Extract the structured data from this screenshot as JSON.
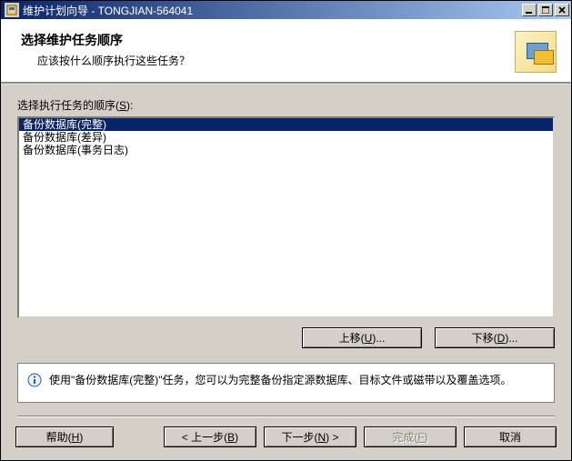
{
  "window": {
    "title": "维护计划向导 - TONGJIAN-564041"
  },
  "header": {
    "heading": "选择维护任务顺序",
    "subheading": "应该按什么顺序执行这些任务？"
  },
  "list_label_prefix": "选择执行任务的顺序(",
  "list_label_hotkey": "S",
  "list_label_suffix": "):",
  "tasks": [
    {
      "label": "备份数据库(完整)",
      "selected": true
    },
    {
      "label": "备份数据库(差异)",
      "selected": false
    },
    {
      "label": "备份数据库(事务日志)",
      "selected": false
    }
  ],
  "buttons": {
    "move_up": {
      "text": "上移(",
      "hotkey": "U",
      "suffix": ")..."
    },
    "move_down": {
      "text": "下移(",
      "hotkey": "D",
      "suffix": ")..."
    },
    "help": {
      "text": "帮助(",
      "hotkey": "H",
      "suffix": ")"
    },
    "back": {
      "text": "< 上一步(",
      "hotkey": "B",
      "suffix": ")"
    },
    "next": {
      "text": "下一步(",
      "hotkey": "N",
      "suffix": ") >"
    },
    "finish": {
      "text": "完成(",
      "hotkey": "F",
      "suffix": ")",
      "disabled": true
    },
    "cancel": {
      "text": "取消"
    }
  },
  "info": {
    "text": "使用\"备份数据库(完整)\"任务，您可以为完整备份指定源数据库、目标文件或磁带以及覆盖选项。"
  }
}
